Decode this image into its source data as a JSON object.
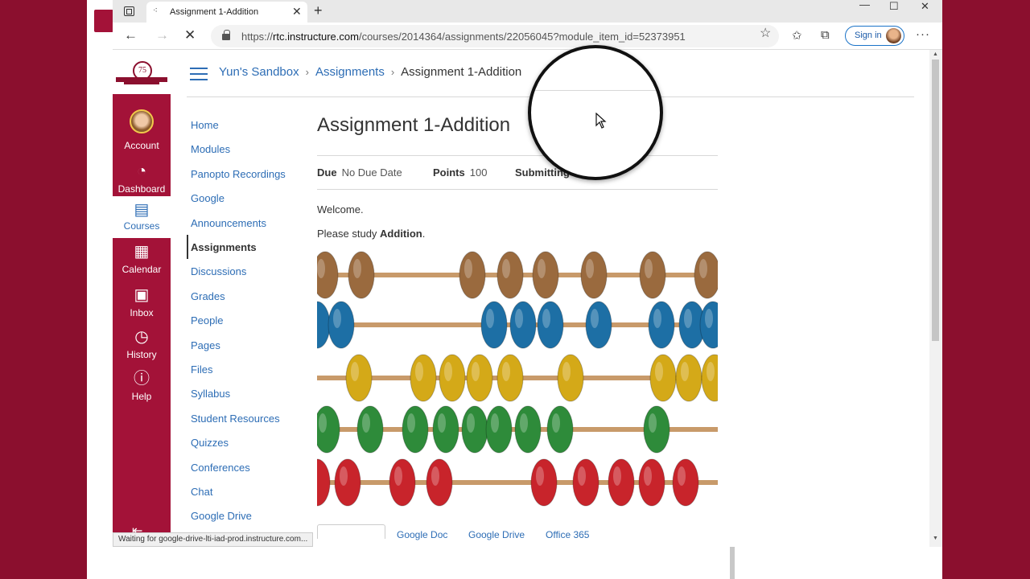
{
  "browser": {
    "tab_title": "Assignment 1-Addition",
    "new_tab": "+",
    "url_prefix": "https://",
    "url_domain": "rtc.instructure.com",
    "url_path": "/courses/2014364/assignments/22056045?module_item_id=52373951",
    "sign_in": "Sign in",
    "status_text": "Waiting for google-drive-lti-iad-prod.instructure.com..."
  },
  "global_nav": {
    "logo_text": "75",
    "items": [
      {
        "label": "Account"
      },
      {
        "label": "Dashboard"
      },
      {
        "label": "Courses"
      },
      {
        "label": "Calendar"
      },
      {
        "label": "Inbox"
      },
      {
        "label": "History"
      },
      {
        "label": "Help"
      }
    ]
  },
  "breadcrumb": {
    "course": "Yun's Sandbox",
    "section": "Assignments",
    "current": "Assignment 1-Addition"
  },
  "course_nav": [
    "Home",
    "Modules",
    "Panopto Recordings",
    "Google",
    "Announcements",
    "Assignments",
    "Discussions",
    "Grades",
    "People",
    "Pages",
    "Files",
    "Syllabus",
    "Student Resources",
    "Quizzes",
    "Conferences",
    "Chat",
    "Google Drive"
  ],
  "course_nav_current": "Assignments",
  "assignment": {
    "title": "Assignment 1-Addition",
    "due_label": "Due",
    "due_value": "No Due Date",
    "points_label": "Points",
    "points_value": "100",
    "submitting_label": "Submitting",
    "welcome": "Welcome.",
    "study_prefix": "Please study ",
    "study_bold": "Addition",
    "study_suffix": "."
  },
  "submission_tabs": [
    "Google Doc",
    "Google Drive",
    "Office 365"
  ],
  "colors": {
    "brand": "#a31238",
    "link": "#2d6db5",
    "bead_rows": [
      "#9a6a3e",
      "#1d6fa5",
      "#d4a918",
      "#2e8b3a",
      "#c8242b"
    ]
  }
}
